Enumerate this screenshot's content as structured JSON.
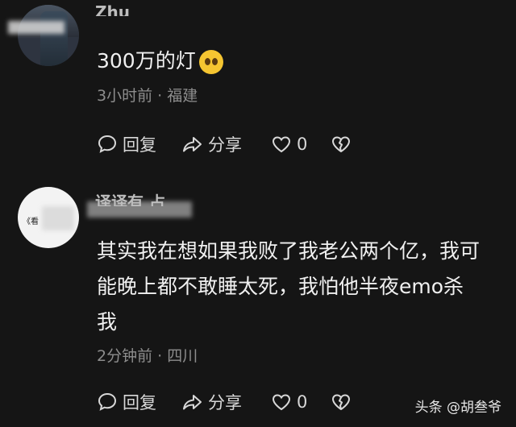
{
  "comments": [
    {
      "username": "Zhu",
      "text_lines": [
        "300万的灯"
      ],
      "emoji": "pleading-face-emoji",
      "meta": "3小时前 · 福建",
      "reply_label": "回复",
      "share_label": "分享",
      "like_count": "0"
    },
    {
      "username": "译译有 占",
      "text_lines": [
        "其实我在想如果我败了我老公两个亿，我可",
        "能晚上都不敢睡太死，我怕他半夜emo杀",
        "我"
      ],
      "meta": "2分钟前 · 四川",
      "reply_label": "回复",
      "share_label": "分享",
      "like_count": "0"
    }
  ],
  "watermark": "头条 @胡叁爷",
  "avatar2_mark": "《看"
}
